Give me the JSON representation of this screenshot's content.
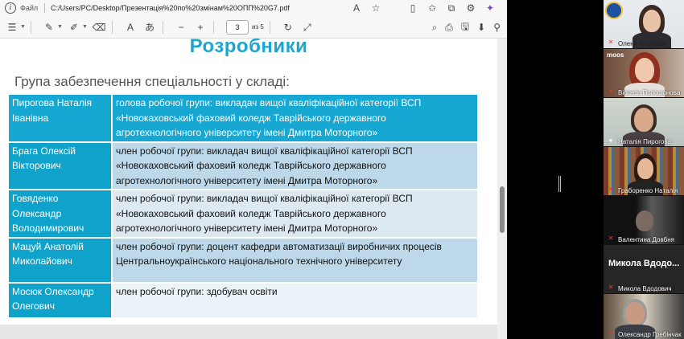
{
  "browser": {
    "file_label": "Файл",
    "url": "C:/Users/PC/Desktop/Презентація%20по%20змінам%20ОПП%20G7.pdf",
    "page_current": "3",
    "page_total": "из 5"
  },
  "slide": {
    "title": "Розробники",
    "subtitle": "Група забезпечення спеціальності у складі:",
    "members": [
      {
        "name": "Пирогова Наталія Іванівна",
        "role": "голова робочої групи: викладач вищої кваліфікаційної категорії ВСП «Новокаховський фаховий коледж Таврійського державного агротехнологічного університету імені Дмитра Моторного»"
      },
      {
        "name": "Брага Олексій Вікторович",
        "role": "член робочої групи: викладач вищої кваліфікаційної категорії ВСП «Новокаховський фаховий коледж Таврійського державного агротехнологічного університету імені Дмитра Моторного»"
      },
      {
        "name": "Говяденко Олександр Володимирович",
        "role": "член робочої групи: викладач вищої кваліфікаційної категорії ВСП «Новокаховський фаховий коледж Таврійського державного агротехнологічного університету імені Дмитра Моторного»"
      },
      {
        "name": "Мацуй Анатолій Миколайович",
        "role": "член робочої групи: доцент кафедри автоматизації виробничих процесів Центральноукраїнського національного технічного університету"
      },
      {
        "name": "Мосюк Олександр Олегович",
        "role": "член робочої групи: здобувач освіти"
      }
    ]
  },
  "participants": [
    {
      "name": "Олена Вітовщик"
    },
    {
      "name": "Віолета Поліхронова",
      "overlay": "moos"
    },
    {
      "name": "Наталія Пирогова"
    },
    {
      "name": "Граборенко Наталія"
    },
    {
      "name": "Валентина Довбня"
    },
    {
      "name": "Микола Вдодович",
      "big_name": "Микола Вдодо..."
    },
    {
      "name": "Олександр Гребінчак"
    }
  ]
}
